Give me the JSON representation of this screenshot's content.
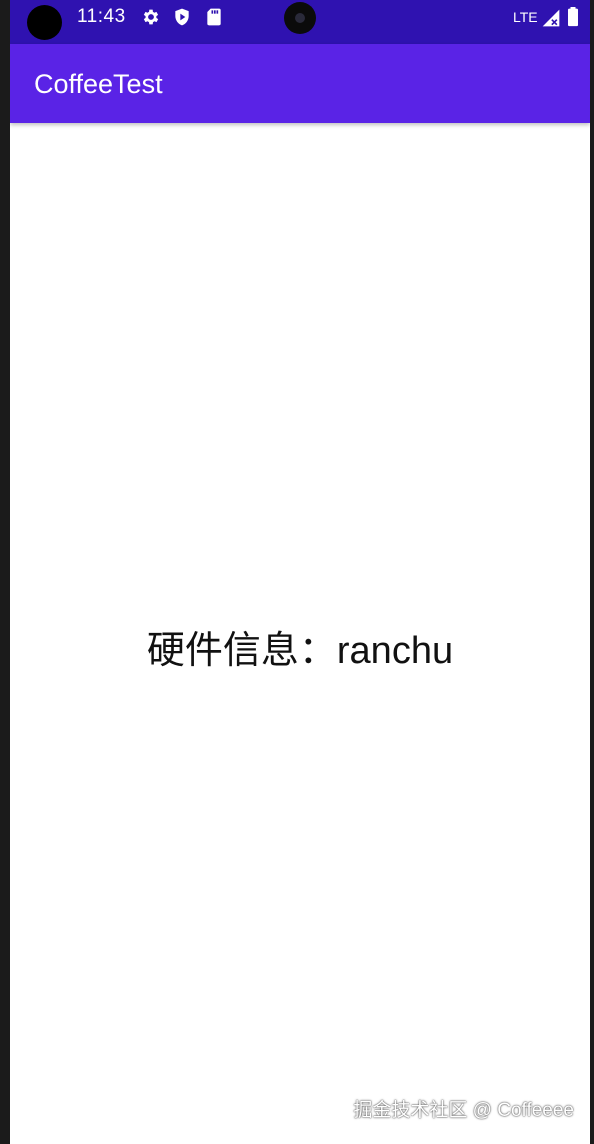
{
  "status_bar": {
    "time": "11:43",
    "network_label": "LTE",
    "icons": [
      "settings-gear-icon",
      "shield-play-icon",
      "sd-card-icon",
      "signal-icon",
      "battery-icon"
    ],
    "background_color": "#2f12b0"
  },
  "app_bar": {
    "title": "CoffeeTest",
    "background_color": "#5a23e6"
  },
  "content": {
    "hardware_info_text": "硬件信息：ranchu"
  },
  "watermark": {
    "text": "掘金技术社区 @ Coffeeee"
  }
}
